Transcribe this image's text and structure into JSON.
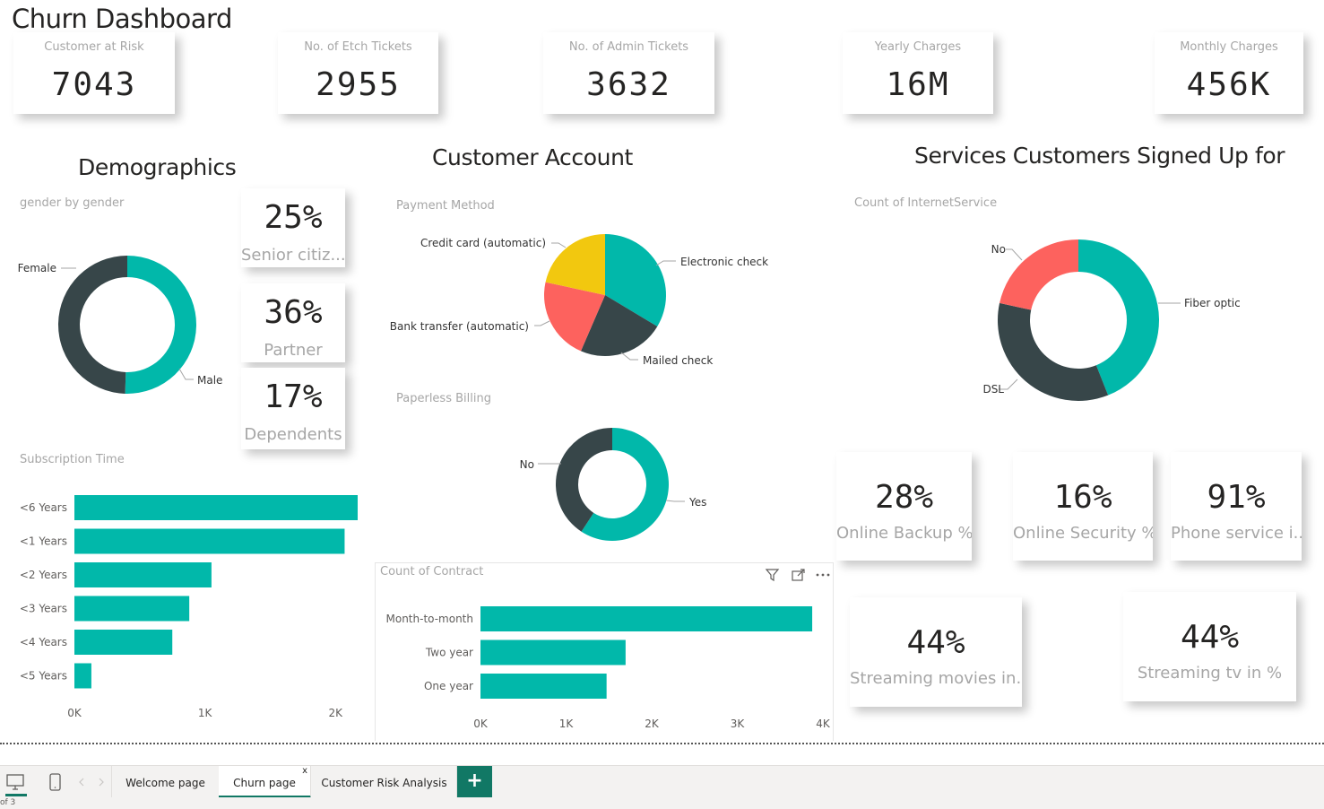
{
  "page_title": "Churn Dashboard",
  "kpis": [
    {
      "label": "Customer at Risk",
      "value": "7043"
    },
    {
      "label": "No. of Etch Tickets",
      "value": "2955"
    },
    {
      "label": "No. of Admin Tickets",
      "value": "3632"
    },
    {
      "label": "Yearly Charges",
      "value": "16M"
    },
    {
      "label": "Monthly Charges",
      "value": "456K"
    }
  ],
  "sections": {
    "demographics": "Demographics",
    "customer_account": "Customer Account",
    "services": "Services Customers Signed Up for"
  },
  "demographic_cards": [
    {
      "value": "25%",
      "label": "Senior citiz..."
    },
    {
      "value": "36%",
      "label": "Partner"
    },
    {
      "value": "17%",
      "label": "Dependents"
    }
  ],
  "service_cards": [
    {
      "value": "28%",
      "label": "Online Backup %"
    },
    {
      "value": "16%",
      "label": "Online Security %"
    },
    {
      "value": "91%",
      "label": "Phone service i..."
    },
    {
      "value": "44%",
      "label": "Streaming movies in..."
    },
    {
      "value": "44%",
      "label": "Streaming tv in %"
    }
  ],
  "colors": {
    "teal": "#01B8AA",
    "dark": "#374649",
    "red": "#FD625E",
    "yellow": "#F2C80F",
    "tab_accent": "#117865"
  },
  "chart_data": [
    {
      "id": "gender",
      "type": "pie",
      "title": "gender by gender",
      "donut": true,
      "categories": [
        "Male",
        "Female"
      ],
      "values": [
        50.5,
        49.5
      ]
    },
    {
      "id": "payment",
      "type": "pie",
      "title": "Payment Method",
      "donut": false,
      "categories": [
        "Electronic check",
        "Mailed check",
        "Bank transfer (automatic)",
        "Credit card (automatic)"
      ],
      "values": [
        33.6,
        22.9,
        21.9,
        21.6
      ]
    },
    {
      "id": "paperless",
      "type": "pie",
      "title": "Paperless Billing",
      "donut": true,
      "categories": [
        "Yes",
        "No"
      ],
      "values": [
        59.2,
        40.8
      ]
    },
    {
      "id": "internet",
      "type": "pie",
      "title": "Count of InternetService",
      "donut": true,
      "categories": [
        "Fiber optic",
        "DSL",
        "No"
      ],
      "values": [
        44,
        34.4,
        21.6
      ]
    },
    {
      "id": "subscription",
      "type": "bar",
      "orientation": "horizontal",
      "title": "Subscription Time",
      "categories": [
        "<6 Years",
        "<1 Years",
        "<2 Years",
        "<3 Years",
        "<4 Years",
        "<5 Years"
      ],
      "values": [
        2170,
        2070,
        1050,
        880,
        750,
        130
      ],
      "xlim": [
        0,
        2170
      ],
      "ticks": [
        "0K",
        "1K",
        "2K"
      ]
    },
    {
      "id": "contract",
      "type": "bar",
      "orientation": "horizontal",
      "title": "Count of Contract",
      "categories": [
        "Month-to-month",
        "Two year",
        "One year"
      ],
      "values": [
        3875,
        1695,
        1473
      ],
      "xlim": [
        0,
        4000
      ],
      "ticks": [
        "0K",
        "1K",
        "2K",
        "3K",
        "4K"
      ]
    }
  ],
  "tabs": [
    {
      "label": "Welcome page"
    },
    {
      "label": "Churn page"
    },
    {
      "label": "Customer Risk Analysis"
    }
  ],
  "tab_close": "x",
  "add_tab": "+",
  "page_count": "of 3"
}
